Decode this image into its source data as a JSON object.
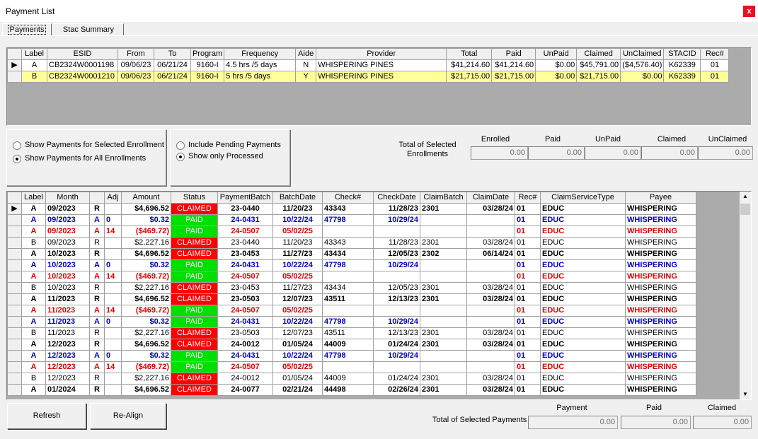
{
  "window": {
    "title": "Payment List",
    "close_label": "x"
  },
  "tabs": [
    {
      "label": "Payments"
    },
    {
      "label": "Stac Summary"
    }
  ],
  "enrollments": {
    "columns": [
      "Label",
      "ESID",
      "From",
      "To",
      "Program",
      "Frequency",
      "Aide",
      "Provider",
      "Total",
      "Paid",
      "UnPaid",
      "Claimed",
      "UnClaimed",
      "STACID",
      "Rec#"
    ],
    "rows": [
      {
        "current": true,
        "cells": [
          "A",
          "CB2324W0001198",
          "09/06/23",
          "06/21/24",
          "9160-I",
          "4.5 hrs /5 days",
          "N",
          "WHISPERING PINES",
          "$41,214.60",
          "$41,214.60",
          "$0.00",
          "$45,791.00",
          "($4,576.40)",
          "K62339",
          "01"
        ]
      },
      {
        "current": false,
        "cells": [
          "B",
          "CB2324W0001210",
          "09/06/23",
          "06/21/24",
          "9160-I",
          "5 hrs /5 days",
          "Y",
          "WHISPERING PINES",
          "$21,715.00",
          "$21,715.00",
          "$0.00",
          "$21,715.00",
          "$0.00",
          "K62339",
          "01"
        ]
      }
    ]
  },
  "filters": {
    "show_selected": "Show Payments for Selected Enrollment",
    "show_all": "Show Payments for All Enrollments",
    "selected_scope": "all",
    "include_pending": "Include Pending Payments",
    "show_processed": "Show only Processed",
    "selected_processing": "processed"
  },
  "enrollment_totals": {
    "label": "Total of Selected Enrollments",
    "headers": [
      "Enrolled",
      "Paid",
      "UnPaid",
      "Claimed",
      "UnClaimed"
    ],
    "values": [
      "0.00",
      "0.00",
      "0.00",
      "0.00",
      "0.00"
    ]
  },
  "payments": {
    "columns": [
      "Label",
      "Month",
      "",
      "Adj",
      "Amount",
      "Status",
      "PaymentBatch",
      "BatchDate",
      "Check#",
      "CheckDate",
      "ClaimBatch",
      "ClaimDate",
      "Rec#",
      "ClaimServiceType",
      "Payee"
    ],
    "rows": [
      {
        "style": "bold",
        "current": true,
        "cells": [
          "A",
          "09/2023",
          "R",
          "",
          "$4,696.52",
          "CLAIMED",
          "23-0440",
          "11/20/23",
          "43343",
          "11/28/23",
          "2301",
          "03/28/24",
          "01",
          "EDUC",
          "WHISPERING"
        ]
      },
      {
        "style": "blue",
        "cells": [
          "A",
          "09/2023",
          "A",
          "0",
          "$0.32",
          "PAID",
          "24-0431",
          "10/22/24",
          "47798",
          "10/29/24",
          "",
          "",
          "01",
          "EDUC",
          "WHISPERING"
        ]
      },
      {
        "style": "red",
        "cells": [
          "A",
          "09/2023",
          "A",
          "14",
          "($469.72)",
          "PAID",
          "24-0507",
          "05/02/25",
          "",
          "",
          "",
          "",
          "01",
          "EDUC",
          "WHISPERING"
        ]
      },
      {
        "style": "normal",
        "cells": [
          "B",
          "09/2023",
          "R",
          "",
          "$2,227.16",
          "CLAIMED",
          "23-0440",
          "11/20/23",
          "43343",
          "11/28/23",
          "2301",
          "03/28/24",
          "01",
          "EDUC",
          "WHISPERING"
        ]
      },
      {
        "style": "bold",
        "cells": [
          "A",
          "10/2023",
          "R",
          "",
          "$4,696.52",
          "CLAIMED",
          "23-0453",
          "11/27/23",
          "43434",
          "12/05/23",
          "2302",
          "06/14/24",
          "01",
          "EDUC",
          "WHISPERING"
        ]
      },
      {
        "style": "blue",
        "cells": [
          "A",
          "10/2023",
          "A",
          "0",
          "$0.32",
          "PAID",
          "24-0431",
          "10/22/24",
          "47798",
          "10/29/24",
          "",
          "",
          "01",
          "EDUC",
          "WHISPERING"
        ]
      },
      {
        "style": "red",
        "cells": [
          "A",
          "10/2023",
          "A",
          "14",
          "($469.72)",
          "PAID",
          "24-0507",
          "05/02/25",
          "",
          "",
          "",
          "",
          "01",
          "EDUC",
          "WHISPERING"
        ]
      },
      {
        "style": "normal",
        "cells": [
          "B",
          "10/2023",
          "R",
          "",
          "$2,227.16",
          "CLAIMED",
          "23-0453",
          "11/27/23",
          "43434",
          "12/05/23",
          "2301",
          "03/28/24",
          "01",
          "EDUC",
          "WHISPERING"
        ]
      },
      {
        "style": "bold",
        "cells": [
          "A",
          "11/2023",
          "R",
          "",
          "$4,696.52",
          "CLAIMED",
          "23-0503",
          "12/07/23",
          "43511",
          "12/13/23",
          "2301",
          "03/28/24",
          "01",
          "EDUC",
          "WHISPERING"
        ]
      },
      {
        "style": "red",
        "cells": [
          "A",
          "11/2023",
          "A",
          "14",
          "($469.72)",
          "PAID",
          "24-0507",
          "05/02/25",
          "",
          "",
          "",
          "",
          "01",
          "EDUC",
          "WHISPERING"
        ]
      },
      {
        "style": "blue",
        "cells": [
          "A",
          "11/2023",
          "A",
          "0",
          "$0.32",
          "PAID",
          "24-0431",
          "10/22/24",
          "47798",
          "10/29/24",
          "",
          "",
          "01",
          "EDUC",
          "WHISPERING"
        ]
      },
      {
        "style": "normal",
        "cells": [
          "B",
          "11/2023",
          "R",
          "",
          "$2,227.16",
          "CLAIMED",
          "23-0503",
          "12/07/23",
          "43511",
          "12/13/23",
          "2301",
          "03/28/24",
          "01",
          "EDUC",
          "WHISPERING"
        ]
      },
      {
        "style": "bold",
        "cells": [
          "A",
          "12/2023",
          "R",
          "",
          "$4,696.52",
          "CLAIMED",
          "24-0012",
          "01/05/24",
          "44009",
          "01/24/24",
          "2301",
          "03/28/24",
          "01",
          "EDUC",
          "WHISPERING"
        ]
      },
      {
        "style": "blue",
        "cells": [
          "A",
          "12/2023",
          "A",
          "0",
          "$0.32",
          "PAID",
          "24-0431",
          "10/22/24",
          "47798",
          "10/29/24",
          "",
          "",
          "01",
          "EDUC",
          "WHISPERING"
        ]
      },
      {
        "style": "red",
        "cells": [
          "A",
          "12/2023",
          "A",
          "14",
          "($469.72)",
          "PAID",
          "24-0507",
          "05/02/25",
          "",
          "",
          "",
          "",
          "01",
          "EDUC",
          "WHISPERING"
        ]
      },
      {
        "style": "normal",
        "cells": [
          "B",
          "12/2023",
          "R",
          "",
          "$2,227.16",
          "CLAIMED",
          "24-0012",
          "01/05/24",
          "44009",
          "01/24/24",
          "2301",
          "03/28/24",
          "01",
          "EDUC",
          "WHISPERING"
        ]
      },
      {
        "style": "bold",
        "cells": [
          "A",
          "01/2024",
          "R",
          "",
          "$4,696.52",
          "CLAIMED",
          "24-0077",
          "02/21/24",
          "44498",
          "02/26/24",
          "2301",
          "03/28/24",
          "01",
          "EDUC",
          "WHISPERING"
        ]
      }
    ]
  },
  "buttons": {
    "refresh": "Refresh",
    "realign": "Re-Align"
  },
  "payment_totals": {
    "label": "Total of Selected Payments",
    "headers": [
      "Payment",
      "Paid",
      "Claimed"
    ],
    "values": [
      "0.00",
      "0.00",
      "0.00"
    ]
  },
  "colors": {
    "claimed": "#ff0000",
    "paid": "#00e000",
    "highlight": "#ffff99",
    "adj_positive": "#0000cc",
    "adj_negative": "#e00000"
  }
}
